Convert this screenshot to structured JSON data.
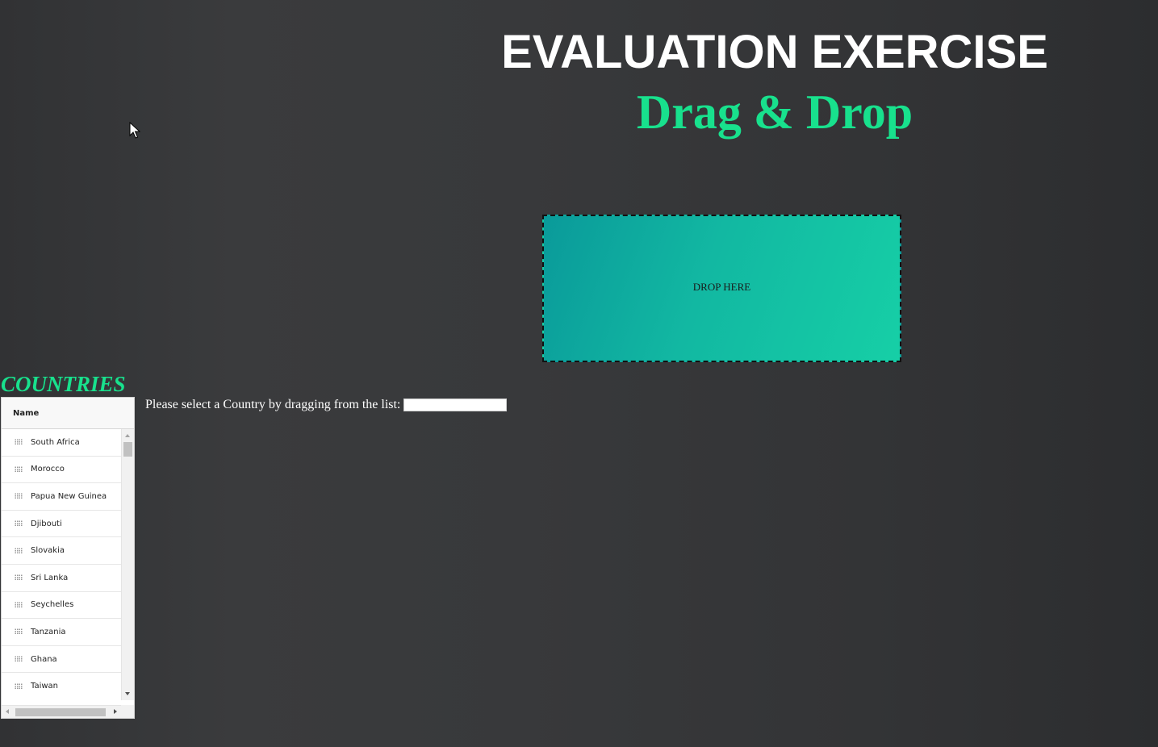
{
  "header": {
    "title": "EVALUATION EXERCISE",
    "subtitle": "Drag & Drop"
  },
  "drop_zone": {
    "label": "DROP HERE"
  },
  "countries": {
    "heading": "COUNTRIES",
    "column_header": "Name",
    "items": [
      "South Africa",
      "Morocco",
      "Papua New Guinea",
      "Djibouti",
      "Slovakia",
      "Sri Lanka",
      "Seychelles",
      "Tanzania",
      "Ghana",
      "Taiwan"
    ]
  },
  "prompt": {
    "label": "Please select a Country by dragging from the list:",
    "input_value": ""
  },
  "colors": {
    "accent": "#18e18d",
    "drop_zone_start": "#0a9a9a",
    "drop_zone_end": "#16cfa6",
    "background": "#38393b"
  },
  "icons": {
    "cursor": "mouse-pointer-icon",
    "row_handle": "drag-handle-icon"
  }
}
